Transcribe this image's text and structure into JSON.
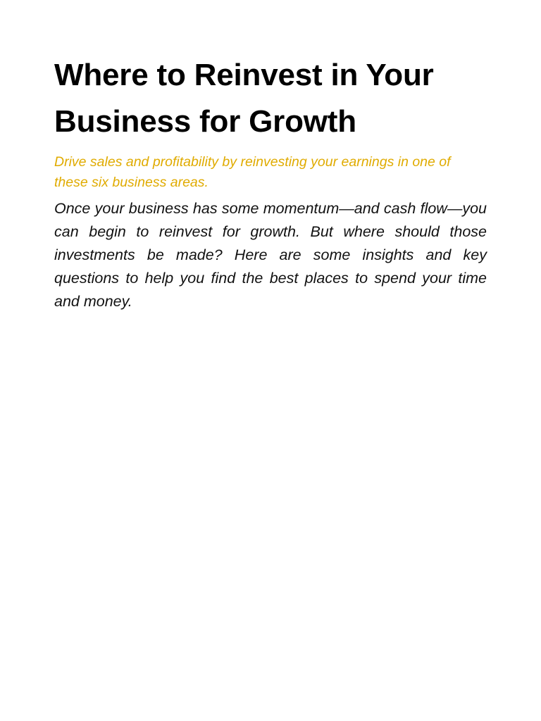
{
  "article": {
    "title": "Where to Reinvest in Your Business for Growth",
    "subtitle": "Drive sales and profitability by reinvesting your earnings in one of these six business areas.",
    "body": "Once your business has some momentum—and cash flow—you can begin to reinvest for growth. But where should those investments be made? Here are some insights and key questions to help you find the best places to spend your time and money."
  },
  "colors": {
    "accent": "#e0ab00",
    "text": "#111111",
    "background": "#ffffff"
  }
}
